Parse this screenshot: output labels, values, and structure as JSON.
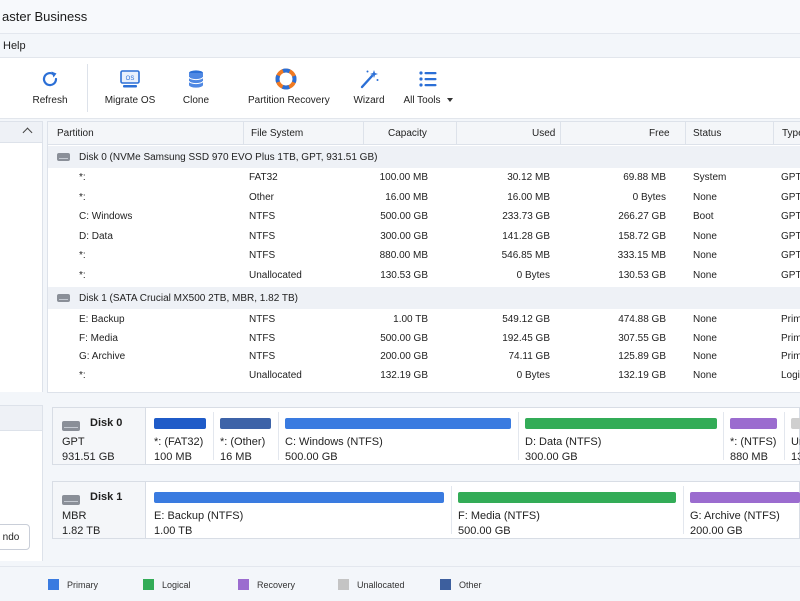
{
  "app": {
    "title": "aster Business"
  },
  "menu": {
    "help": "Help"
  },
  "toolbar": {
    "refresh": "Refresh",
    "migrate_os": "Migrate OS",
    "clone": "Clone",
    "partition_recovery": "Partition Recovery",
    "wizard": "Wizard",
    "all_tools": "All Tools",
    "os_icon_text": "OS"
  },
  "columns": [
    "Partition",
    "File System",
    "Capacity",
    "Used",
    "Free",
    "Status",
    "Type"
  ],
  "disks": [
    {
      "header": "Disk 0 (NVMe Samsung SSD 970 EVO Plus 1TB, GPT, 931.51 GB)",
      "rows": [
        {
          "partition": "*:",
          "fs": "FAT32",
          "capacity": "100.00 MB",
          "used": "30.12 MB",
          "free": "69.88 MB",
          "status": "System",
          "type": "GPT"
        },
        {
          "partition": "*:",
          "fs": "Other",
          "capacity": "16.00 MB",
          "used": "16.00 MB",
          "free": "0 Bytes",
          "status": "None",
          "type": "GPT"
        },
        {
          "partition": "C: Windows",
          "fs": "NTFS",
          "capacity": "500.00 GB",
          "used": "233.73 GB",
          "free": "266.27 GB",
          "status": "Boot",
          "type": "GPT"
        },
        {
          "partition": "D: Data",
          "fs": "NTFS",
          "capacity": "300.00 GB",
          "used": "141.28 GB",
          "free": "158.72 GB",
          "status": "None",
          "type": "GPT"
        },
        {
          "partition": "*:",
          "fs": "NTFS",
          "capacity": "880.00 MB",
          "used": "546.85 MB",
          "free": "333.15 MB",
          "status": "None",
          "type": "GPT"
        },
        {
          "partition": "*:",
          "fs": "Unallocated",
          "capacity": "130.53 GB",
          "used": "0 Bytes",
          "free": "130.53 GB",
          "status": "None",
          "type": "GPT"
        }
      ]
    },
    {
      "header": "Disk 1 (SATA Crucial MX500 2TB, MBR, 1.82 TB)",
      "rows": [
        {
          "partition": "E: Backup",
          "fs": "NTFS",
          "capacity": "1.00 TB",
          "used": "549.12 GB",
          "free": "474.88 GB",
          "status": "None",
          "type": "Prima"
        },
        {
          "partition": "F: Media",
          "fs": "NTFS",
          "capacity": "500.00 GB",
          "used": "192.45 GB",
          "free": "307.55 GB",
          "status": "None",
          "type": "Prima"
        },
        {
          "partition": "G: Archive",
          "fs": "NTFS",
          "capacity": "200.00 GB",
          "used": "74.11 GB",
          "free": "125.89 GB",
          "status": "None",
          "type": "Prima"
        },
        {
          "partition": "*:",
          "fs": "Unallocated",
          "capacity": "132.19 GB",
          "used": "0 Bytes",
          "free": "132.19 GB",
          "status": "None",
          "type": "Logica"
        }
      ]
    }
  ],
  "disk_map": [
    {
      "name": "Disk 0",
      "style": "GPT",
      "size": "931.51 GB",
      "segments": [
        {
          "label": "*: (FAT32)",
          "size": "100 MB",
          "color": "#1f5bc8"
        },
        {
          "label": "*: (Other)",
          "size": "16 MB",
          "color": "#3d63a8"
        },
        {
          "label": "C: Windows (NTFS)",
          "size": "500.00 GB",
          "color": "#3a7be0"
        },
        {
          "label": "D: Data (NTFS)",
          "size": "300.00 GB",
          "color": "#33ac57"
        },
        {
          "label": "*: (NTFS)",
          "size": "880 MB",
          "color": "#9b6ccf"
        },
        {
          "label": "Un",
          "size": "13",
          "color": "#cfcfcf"
        }
      ]
    },
    {
      "name": "Disk 1",
      "style": "MBR",
      "size": "1.82 TB",
      "segments": [
        {
          "label": "E: Backup (NTFS)",
          "size": "1.00 TB",
          "color": "#3a7be0"
        },
        {
          "label": "F: Media (NTFS)",
          "size": "500.00 GB",
          "color": "#33ac57"
        },
        {
          "label": "G: Archive (NTFS)",
          "size": "200.00 GB",
          "color": "#9b6ccf"
        }
      ]
    }
  ],
  "sidebar": {
    "undo": "ndo"
  },
  "legend": [
    {
      "label": "Primary",
      "color": "#3a7be0"
    },
    {
      "label": "Logical",
      "color": "#33ac57"
    },
    {
      "label": "Recovery",
      "color": "#9b6ccf"
    },
    {
      "label": "Unallocated",
      "color": "#c4c4c4"
    },
    {
      "label": "Other",
      "color": "#3d5f9e"
    }
  ]
}
